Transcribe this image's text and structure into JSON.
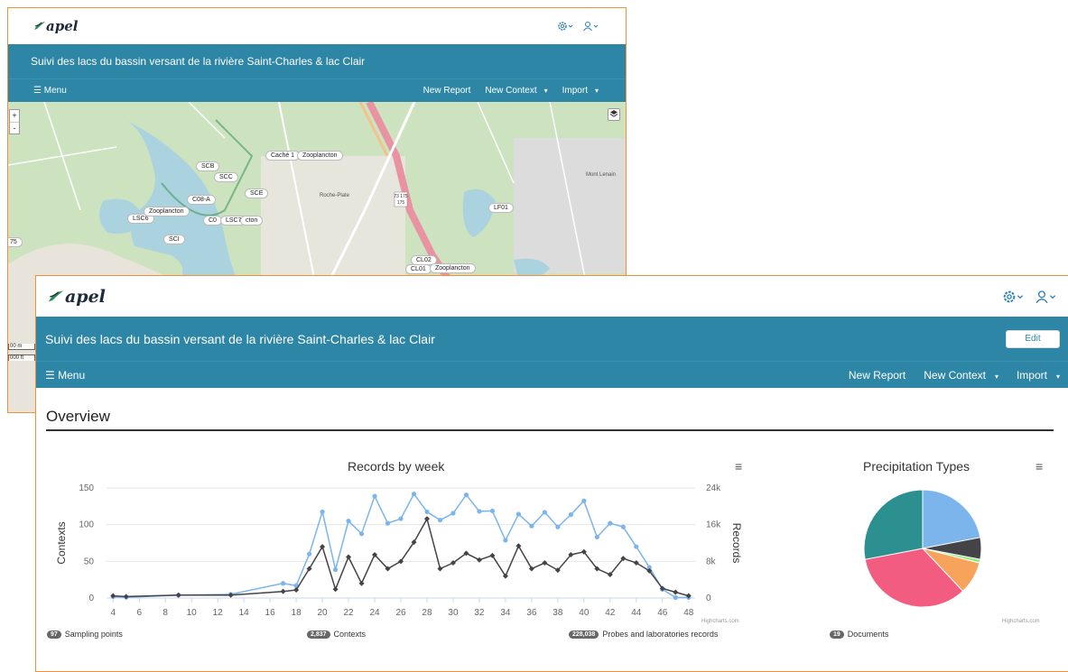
{
  "app": {
    "brand": "apel",
    "site_title": "Suivi des lacs du bassin versant de la rivière Saint-Charles & lac Clair",
    "menu_label": "Menu",
    "menu_icon": "hamburger-icon",
    "settings_icon": "gear-icon",
    "user_icon": "user-icon",
    "nav": {
      "new_report": "New Report",
      "new_context": "New Context",
      "import": "Import"
    },
    "edit_label": "Edit"
  },
  "map": {
    "zoom_in": "+",
    "zoom_out": "-",
    "layers_icon": "layers-icon",
    "scale_m": "00 m",
    "scale_ft": "000 ft",
    "labels": [
      "Caché 1",
      "Zooplancton",
      "SCB",
      "SCC",
      "SCE",
      "C08-A",
      "LSC6",
      "Zooplancton",
      "C0",
      "LSC7",
      "cton",
      "SCI",
      "LF01",
      "CL02",
      "CL01",
      "Zooplancton",
      "75"
    ],
    "place_names": [
      "Roche-Plate",
      "Mont Lenain"
    ],
    "road_shield": "73\n175"
  },
  "overview": {
    "heading": "Overview",
    "stats": [
      {
        "count": "97",
        "label": "Sampling points"
      },
      {
        "count": "2,837",
        "label": "Contexts"
      },
      {
        "count": "228,038",
        "label": "Probes and laboratories records"
      },
      {
        "count": "19",
        "label": "Documents"
      }
    ]
  },
  "chart_data": [
    {
      "type": "line",
      "title": "Records by week",
      "ylabel": "Contexts",
      "y2label": "Records",
      "ylim": [
        0,
        150
      ],
      "y2lim": [
        0,
        24000
      ],
      "yticks": [
        "0",
        "50",
        "100",
        "150"
      ],
      "y2ticks": [
        "0",
        "8k",
        "16k",
        "24k"
      ],
      "xticks": [
        "4",
        "6",
        "8",
        "10",
        "12",
        "14",
        "16",
        "18",
        "20",
        "22",
        "24",
        "26",
        "28",
        "30",
        "32",
        "34",
        "36",
        "38",
        "40",
        "42",
        "44",
        "46",
        "48"
      ],
      "credits": "Highcharts.com",
      "series": [
        {
          "name": "Records",
          "axis": "right",
          "color": "#7cb5ec",
          "x": [
            4,
            5,
            9,
            13,
            17,
            18,
            19,
            20,
            21,
            22,
            23,
            24,
            25,
            26,
            27,
            28,
            29,
            30,
            31,
            32,
            33,
            34,
            35,
            36,
            37,
            38,
            39,
            40,
            41,
            42,
            43,
            44,
            45,
            46,
            47,
            48
          ],
          "values": [
            320,
            160,
            640,
            800,
            3200,
            2700,
            9600,
            18800,
            6200,
            16800,
            14000,
            22200,
            16300,
            17300,
            22700,
            18800,
            17000,
            18500,
            22500,
            18900,
            19000,
            12600,
            18300,
            15700,
            18700,
            15500,
            18200,
            21200,
            13300,
            16300,
            15500,
            11200,
            6700,
            1900,
            100,
            150
          ]
        },
        {
          "name": "Contexts",
          "axis": "left",
          "color": "#434348",
          "x": [
            4,
            5,
            9,
            13,
            17,
            18,
            19,
            20,
            21,
            22,
            23,
            24,
            25,
            26,
            27,
            28,
            29,
            30,
            31,
            32,
            33,
            34,
            35,
            36,
            37,
            38,
            39,
            40,
            41,
            42,
            43,
            44,
            45,
            46,
            47,
            48
          ],
          "values": [
            3,
            2,
            4,
            4,
            9,
            11,
            40,
            70,
            12,
            56,
            20,
            59,
            40,
            50,
            76,
            108,
            40,
            48,
            61,
            52,
            58,
            30,
            71,
            40,
            48,
            38,
            59,
            63,
            40,
            32,
            54,
            48,
            37,
            13,
            8,
            3
          ]
        }
      ]
    },
    {
      "type": "pie",
      "title": "Precipitation Types",
      "credits": "Highcharts.com",
      "slices": [
        {
          "value": 22,
          "color": "#7cb5ec"
        },
        {
          "value": 6,
          "color": "#434348"
        },
        {
          "value": 1,
          "color": "#90ed7d"
        },
        {
          "value": 9,
          "color": "#f7a35c"
        },
        {
          "value": 34,
          "color": "#f15c80"
        },
        {
          "value": 28,
          "color": "#2b908f"
        }
      ]
    }
  ]
}
